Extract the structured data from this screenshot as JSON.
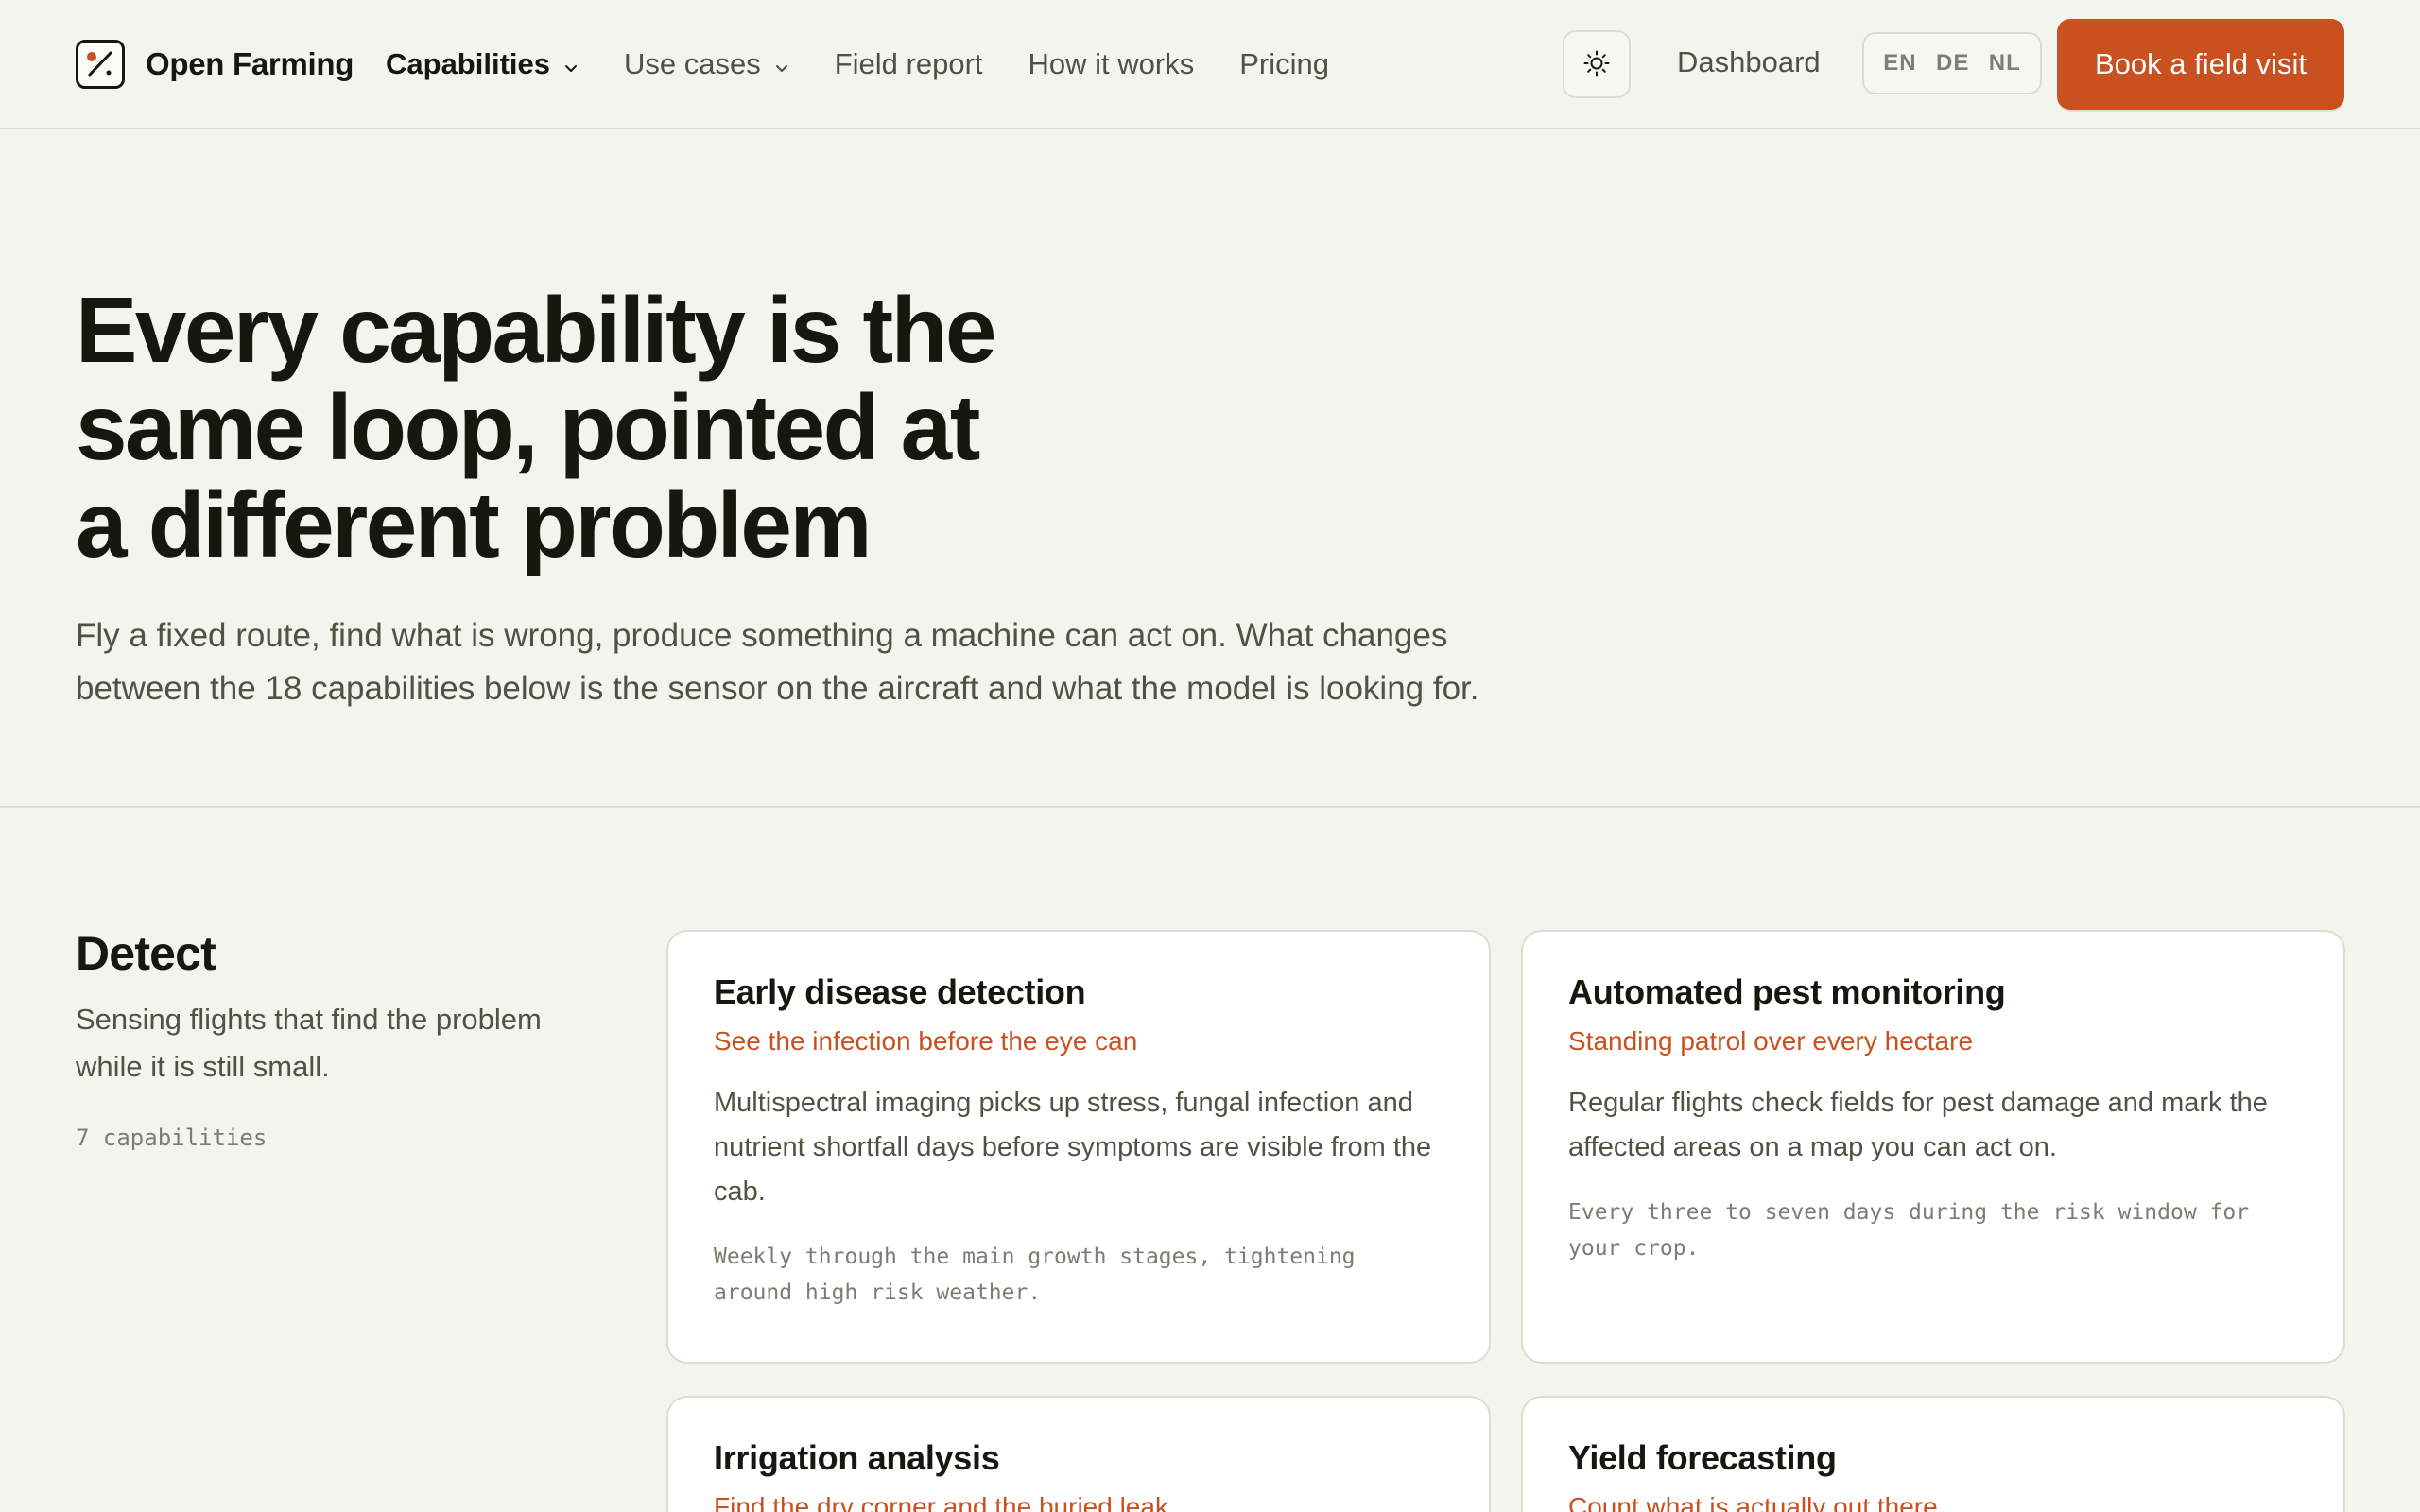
{
  "header": {
    "brand": "Open Farming",
    "nav": [
      {
        "label": "Capabilities",
        "has_dropdown": true,
        "active": true
      },
      {
        "label": "Use cases",
        "has_dropdown": true,
        "active": false
      },
      {
        "label": "Field report",
        "has_dropdown": false,
        "active": false
      },
      {
        "label": "How it works",
        "has_dropdown": false,
        "active": false
      },
      {
        "label": "Pricing",
        "has_dropdown": false,
        "active": false
      }
    ],
    "theme_icon": "sun-icon",
    "dashboard": "Dashboard",
    "languages": [
      "EN",
      "DE",
      "NL"
    ],
    "cta": "Book a field visit"
  },
  "hero": {
    "title_lines": [
      "Every capability is the",
      "same loop, pointed at",
      "a different problem"
    ],
    "subtitle": "Fly a fixed route, find what is wrong, produce something a machine can act on. What changes between the 18 capabilities below is the sensor on the aircraft and what the model is looking for."
  },
  "section": {
    "title": "Detect",
    "description": "Sensing flights that find the problem while it is still small.",
    "count": "7 capabilities",
    "cards": [
      {
        "title": "Early disease detection",
        "tagline": "See the infection before the eye can",
        "body": "Multispectral imaging picks up stress, fungal infection and nutrient shortfall days before symptoms are visible from the cab.",
        "meta": "Weekly through the main growth stages, tightening around high risk weather."
      },
      {
        "title": "Automated pest monitoring",
        "tagline": "Standing patrol over every hectare",
        "body": "Regular flights check fields for pest damage and mark the affected areas on a map you can act on.",
        "meta": "Every three to seven days during the risk window for your crop."
      },
      {
        "title": "Irrigation analysis",
        "tagline": "Find the dry corner and the buried leak",
        "body": "",
        "meta": ""
      },
      {
        "title": "Yield forecasting",
        "tagline": "Count what is actually out there",
        "body": "",
        "meta": ""
      }
    ]
  },
  "colors": {
    "accent": "#c9501f",
    "background": "#f4f4ef",
    "text": "#16170f",
    "muted": "#4f5343"
  }
}
